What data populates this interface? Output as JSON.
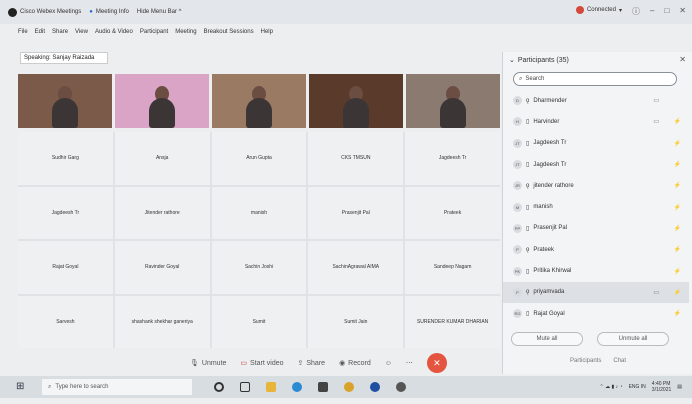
{
  "titlebar": {
    "app": "Cisco Webex Meetings",
    "tab_meeting_info": "Meeting Info",
    "tab_hide_menu": "Hide Menu Bar ^",
    "connection": "Connected",
    "status_color": "#d34a3a"
  },
  "menu": [
    "File",
    "Edit",
    "Share",
    "View",
    "Audio & Video",
    "Participant",
    "Meeting",
    "Breakout Sessions",
    "Help"
  ],
  "speaking": "Speaking: Sanjay Raizada",
  "video_tiles": [
    {
      "bg": "#7b5a4a"
    },
    {
      "bg": "#d9a4c5"
    },
    {
      "bg": "#9b7a64"
    },
    {
      "bg": "#5a3b2b"
    },
    {
      "bg": "#8a7a70"
    }
  ],
  "grid_names": [
    "Sudhir Garg",
    "Ansja",
    "Arun Gupta",
    "CKS TMSUN",
    "Jagdeesh Tr",
    "Jagdeesh Tr",
    "Jitender rathore",
    "manish",
    "Prasenjit Pal",
    "Prateek",
    "Rajat Goyal",
    "Ravinder Goyal",
    "Sachin Joshi",
    "SachinAgrawal AIMA",
    "Sandeep Nagam",
    "Sarvesh",
    "shashank shekhar ganeriya",
    "Sumit",
    "Sumit Jain",
    "SURENDER KUMAR DHARIAN"
  ],
  "controls": {
    "unmute": "Unmute",
    "start_video": "Start video",
    "share": "Share",
    "record": "Record"
  },
  "panel": {
    "title": "Participants (35)",
    "search_placeholder": "Search",
    "participants": [
      {
        "initials": "D",
        "name": "Dharmender",
        "cam": "▭",
        "muted": ""
      },
      {
        "initials": "H",
        "name": "Harvinder",
        "cam": "▭",
        "muted": "⚡"
      },
      {
        "initials": "JT",
        "name": "Jagdeesh Tr",
        "cam": "",
        "muted": "⚡"
      },
      {
        "initials": "JT",
        "name": "Jagdeesh Tr",
        "cam": "",
        "muted": "⚡"
      },
      {
        "initials": "JR",
        "name": "jitender rathore",
        "cam": "",
        "muted": "⚡"
      },
      {
        "initials": "M",
        "name": "manish",
        "cam": "",
        "muted": "⚡"
      },
      {
        "initials": "PP",
        "name": "Prasenjit Pal",
        "cam": "",
        "muted": "⚡"
      },
      {
        "initials": "P",
        "name": "Prateek",
        "cam": "",
        "muted": "⚡"
      },
      {
        "initials": "PK",
        "name": "Pritika Khirwal",
        "cam": "",
        "muted": "⚡"
      },
      {
        "initials": "P",
        "name": "priyamvada",
        "cam": "▭",
        "muted": "⚡"
      },
      {
        "initials": "RG",
        "name": "Rajat Goyal",
        "cam": "",
        "muted": "⚡"
      }
    ],
    "mute_all": "Mute all",
    "unmute_all": "Unmute all"
  },
  "bottom_tabs": {
    "participants": "Participants",
    "chat": "Chat"
  },
  "taskbar": {
    "search_placeholder": "Type here to search",
    "lang": "ENG IN",
    "time": "4:40 PM",
    "date": "3/1/2021"
  }
}
